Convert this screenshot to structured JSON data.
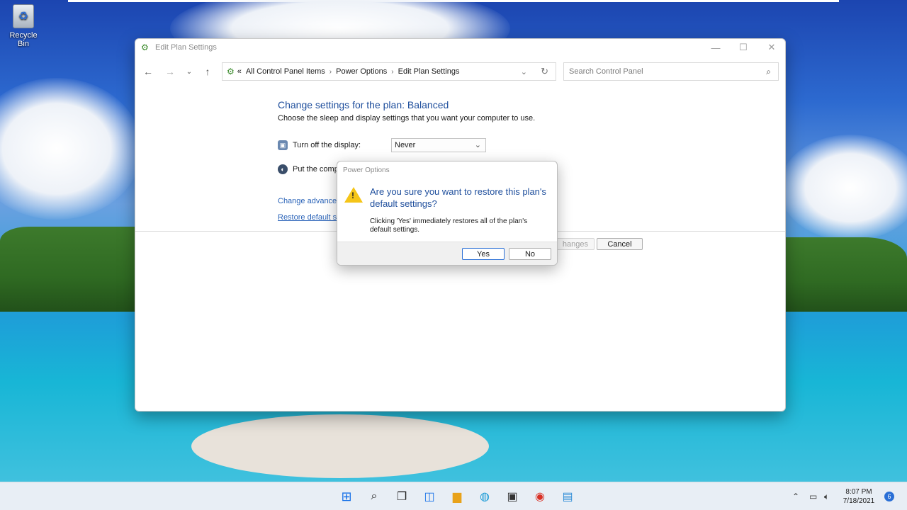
{
  "desktop": {
    "recycle_bin_label": "Recycle Bin"
  },
  "window": {
    "title": "Edit Plan Settings",
    "breadcrumb": {
      "overflow": "«",
      "items": [
        "All Control Panel Items",
        "Power Options",
        "Edit Plan Settings"
      ]
    },
    "search_placeholder": "Search Control Panel",
    "heading": "Change settings for the plan: Balanced",
    "subheading": "Choose the sleep and display settings that you want your computer to use.",
    "display_setting": {
      "label": "Turn off the display:",
      "value": "Never"
    },
    "sleep_setting": {
      "label": "Put the comp"
    },
    "links": {
      "advanced": "Change advanced",
      "restore": "Restore default se"
    },
    "buttons": {
      "save_partial": "hanges",
      "cancel": "Cancel"
    }
  },
  "dialog": {
    "title": "Power Options",
    "main_instruction": "Are you sure you want to restore this plan's default settings?",
    "content": "Clicking 'Yes' immediately restores all of the plan's default settings.",
    "yes": "Yes",
    "no": "No"
  },
  "taskbar": {
    "time": "8:07 PM",
    "date": "7/18/2021",
    "notifications": "6",
    "icons": [
      "start-icon",
      "search-icon",
      "task-view-icon",
      "widgets-icon",
      "file-explorer-icon",
      "edge-icon",
      "store-icon",
      "chrome-icon",
      "control-panel-icon"
    ]
  },
  "colors": {
    "accent": "#2a6fd6",
    "heading_blue": "#1e4e9c",
    "link_blue": "#2a63b8",
    "warning_yellow": "#f5c518"
  }
}
